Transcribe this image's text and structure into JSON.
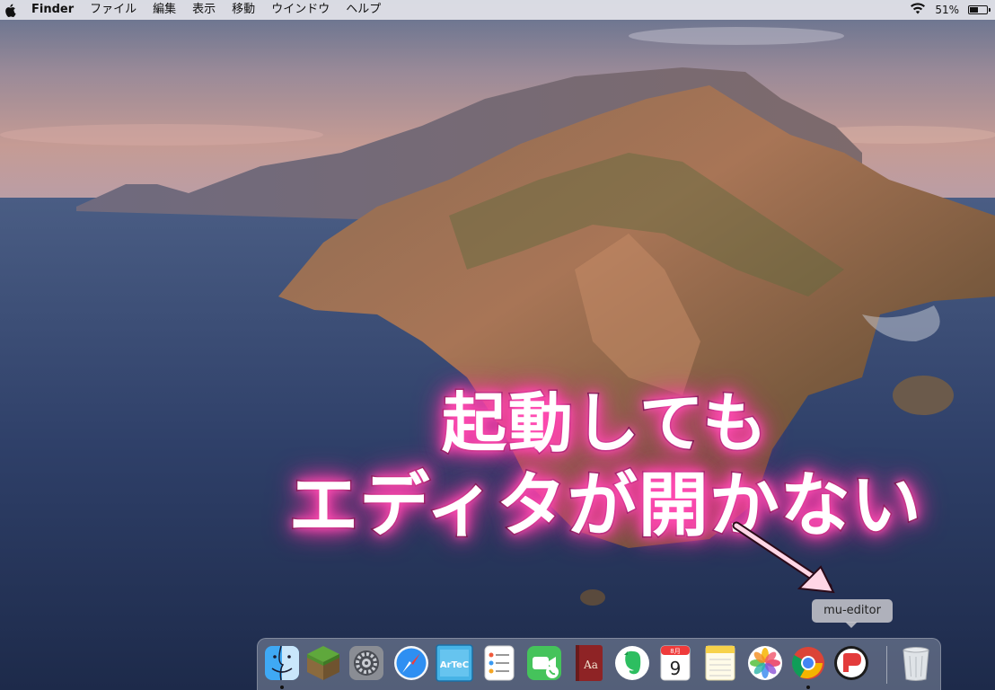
{
  "menubar": {
    "apple_icon": "apple-logo-icon",
    "app_name": "Finder",
    "items": [
      "ファイル",
      "編集",
      "表示",
      "移動",
      "ウインドウ",
      "ヘルプ"
    ],
    "wifi_icon": "wifi-icon",
    "battery_percent": "51%",
    "battery_level": 0.51
  },
  "overlay": {
    "line1": "起動しても",
    "line2": "エディタが開かない",
    "glow_color": "#ff4fb4"
  },
  "tooltip": {
    "text": "mu-editor"
  },
  "dock": {
    "apps": [
      {
        "name": "finder",
        "icon": "finder-icon",
        "running": true
      },
      {
        "name": "minecraft",
        "icon": "minecraft-icon",
        "running": false
      },
      {
        "name": "system-preferences",
        "icon": "system-preferences-icon",
        "running": false
      },
      {
        "name": "safari",
        "icon": "safari-icon",
        "running": false
      },
      {
        "name": "artec",
        "icon": "artec-icon",
        "running": false
      },
      {
        "name": "reminders",
        "icon": "reminders-icon",
        "running": false
      },
      {
        "name": "facetime",
        "icon": "facetime-icon",
        "running": false
      },
      {
        "name": "dictionary",
        "icon": "dictionary-icon",
        "running": false
      },
      {
        "name": "evernote",
        "icon": "evernote-icon",
        "running": false
      },
      {
        "name": "calendar",
        "icon": "calendar-icon",
        "running": false
      },
      {
        "name": "notes",
        "icon": "notes-icon",
        "running": false
      },
      {
        "name": "photos",
        "icon": "photos-icon",
        "running": false
      },
      {
        "name": "chrome",
        "icon": "chrome-icon",
        "running": true
      },
      {
        "name": "mu-editor",
        "icon": "mu-editor-icon",
        "running": false
      },
      {
        "name": "trash",
        "icon": "trash-icon",
        "running": false
      }
    ],
    "artec_label": "ArTeC",
    "dictionary_label": "Aa",
    "calendar_month": "8月",
    "calendar_day": "9"
  }
}
